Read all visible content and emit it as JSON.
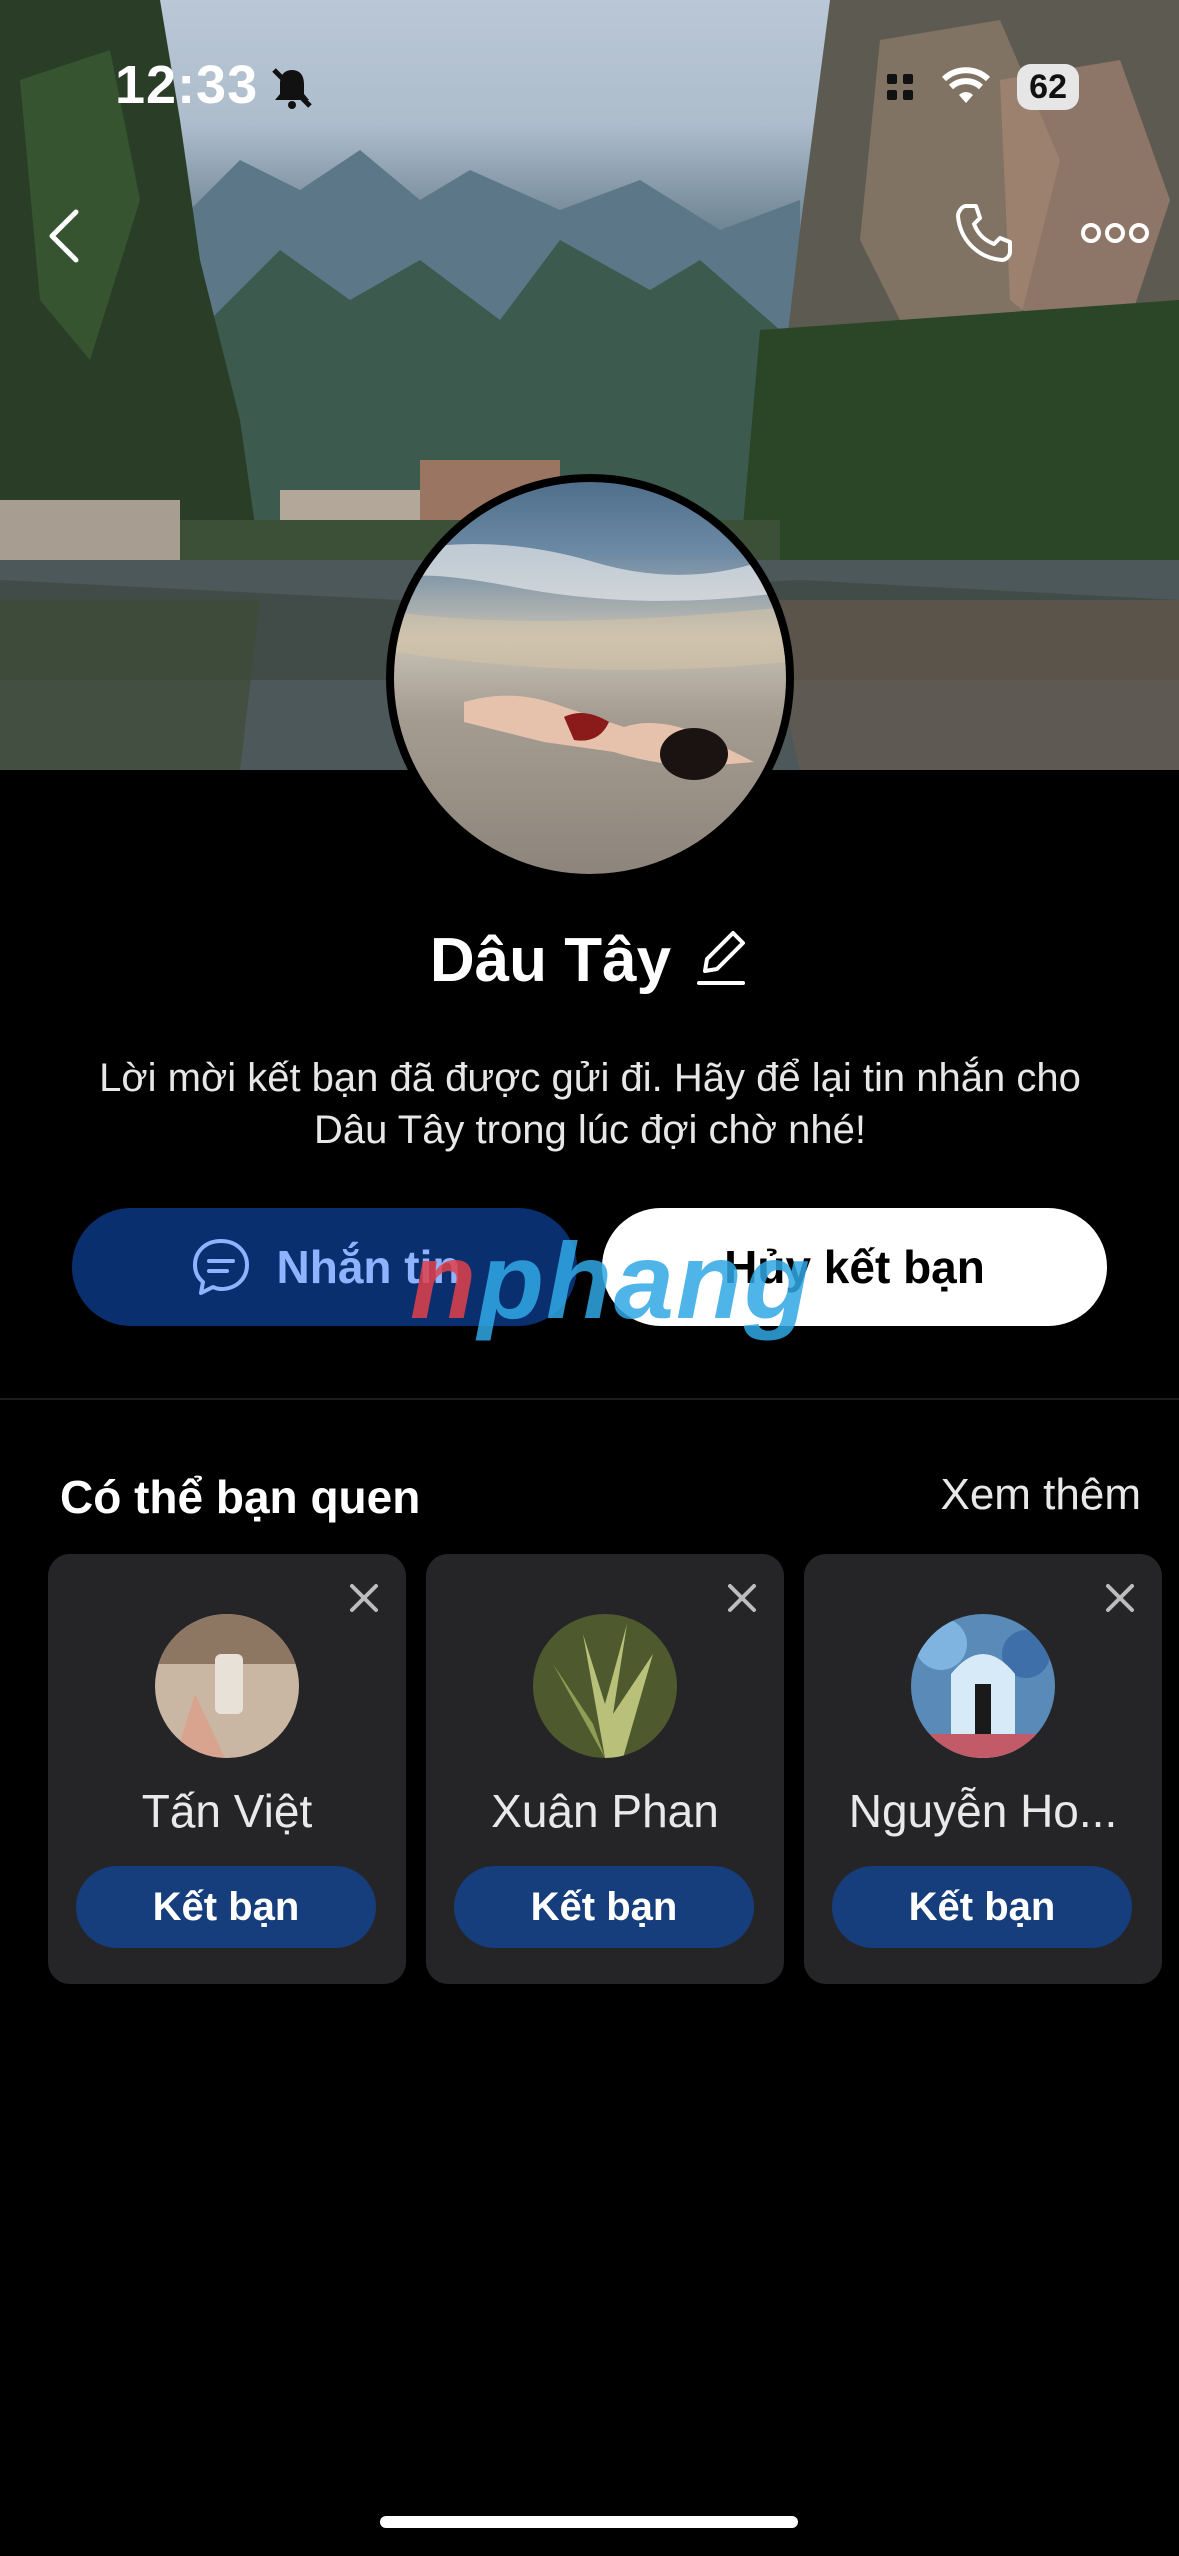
{
  "status_bar": {
    "time": "12:33",
    "battery": "62",
    "icons": [
      "bell-slash-icon",
      "signal-icon",
      "wifi-icon",
      "battery-icon"
    ]
  },
  "header": {
    "icons": [
      "back-chevron-icon",
      "phone-icon",
      "more-dots-icon"
    ]
  },
  "profile": {
    "name": "Dâu Tây",
    "description": "Lời mời kết bạn đã được gửi đi. Hãy để lại tin nhắn cho Dâu Tây trong lúc đợi chờ nhé!"
  },
  "actions": {
    "message_label": "Nhắn tin",
    "cancel_label": "Hủy kết bạn"
  },
  "watermark": {
    "part1": "n",
    "part2": "phang"
  },
  "suggestions": {
    "title": "Có thể bạn quen",
    "see_more": "Xem thêm",
    "items": [
      {
        "name": "Tấn Việt",
        "button": "Kết bạn"
      },
      {
        "name": "Xuân Phan",
        "button": "Kết bạn"
      },
      {
        "name": "Nguyễn Ho...",
        "button": "Kết bạn"
      }
    ]
  },
  "colors": {
    "primary_button": "#0a2f6e",
    "add_button": "#163d7c",
    "card_bg": "#252527"
  }
}
